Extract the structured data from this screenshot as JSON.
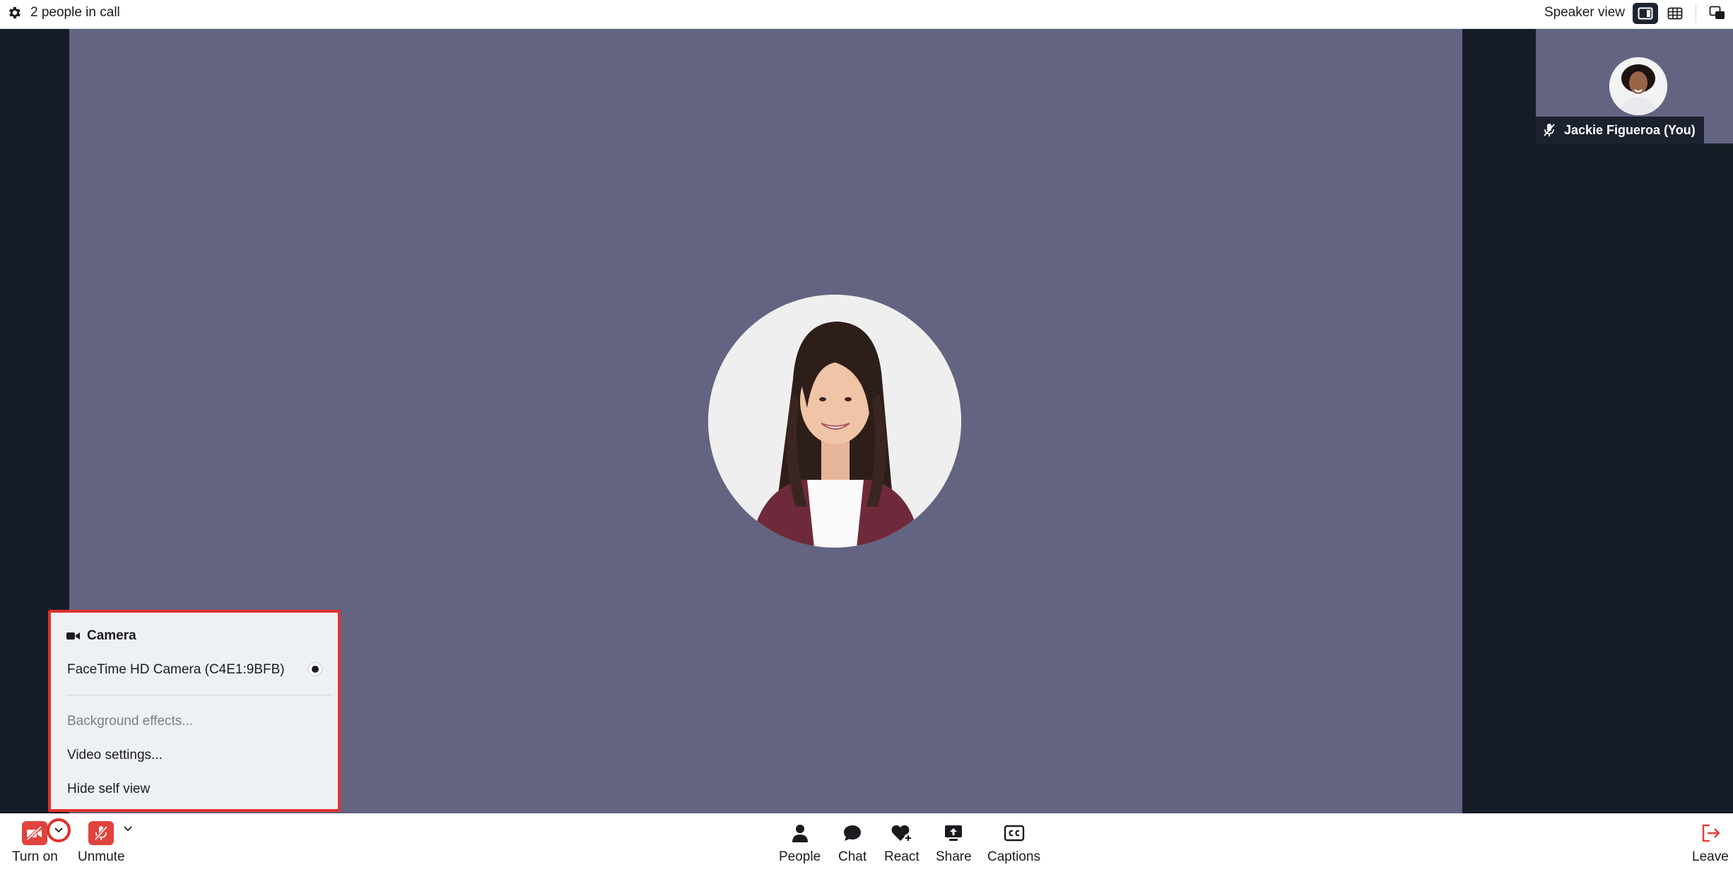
{
  "topbar": {
    "people_count": "2 people in call",
    "view_label": "Speaker view"
  },
  "speaker": {
    "avatar_desc": "speaker-avatar"
  },
  "self_view": {
    "name": "Jackie Figueroa (You)"
  },
  "camera_menu": {
    "title": "Camera",
    "device": "FaceTime HD Camera (C4E1:9BFB)",
    "items": [
      {
        "label": "Background effects...",
        "disabled": true
      },
      {
        "label": "Video settings...",
        "disabled": false
      },
      {
        "label": "Hide self view",
        "disabled": false
      }
    ]
  },
  "toolbar": {
    "camera_label": "Turn on",
    "mic_label": "Unmute",
    "people_label": "People",
    "chat_label": "Chat",
    "react_label": "React",
    "share_label": "Share",
    "captions_label": "Captions",
    "leave_label": "Leave"
  },
  "colors": {
    "stage_bg": "#161c26",
    "speaker_tile": "#636482",
    "alert_red": "#e0433d",
    "highlight_border": "#e0312b"
  }
}
